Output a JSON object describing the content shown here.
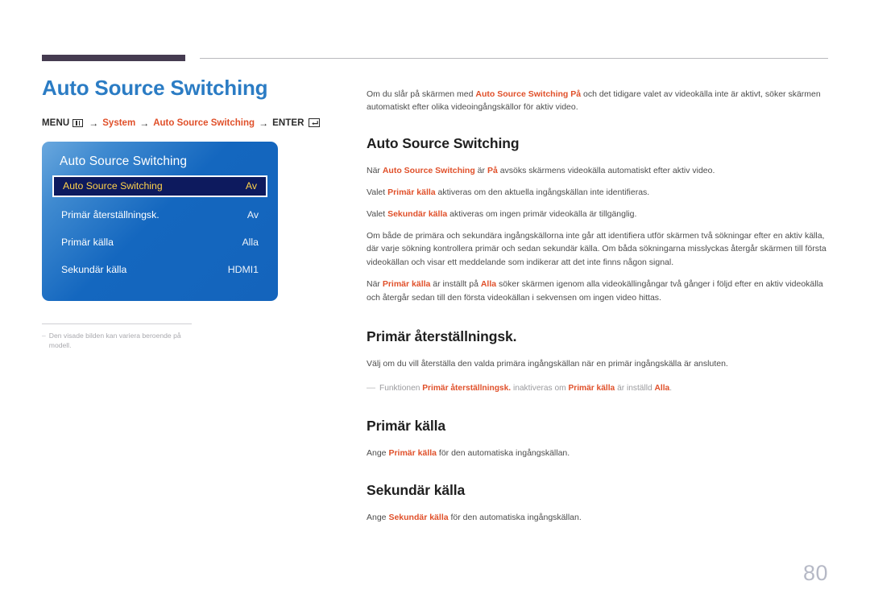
{
  "page": {
    "number": "80"
  },
  "left": {
    "title": "Auto Source Switching",
    "breadcrumb": {
      "menu_label": "MENU",
      "menu_icon": "menu-grid-icon",
      "arrow": "→",
      "item_system": "System",
      "item_auto_source": "Auto Source Switching",
      "enter_label": "ENTER",
      "enter_icon": "enter-return-icon"
    },
    "osd": {
      "title": "Auto Source Switching",
      "rows": [
        {
          "label": "Auto Source Switching",
          "value": "Av",
          "selected": true
        },
        {
          "label": "Primär återställningsk.",
          "value": "Av",
          "selected": false
        },
        {
          "label": "Primär källa",
          "value": "Alla",
          "selected": false
        },
        {
          "label": "Sekundär källa",
          "value": "HDMI1",
          "selected": false
        }
      ]
    },
    "note": {
      "dash": "–",
      "text": "Den visade bilden kan variera beroende på modell."
    }
  },
  "right": {
    "intro": {
      "p1_a": "Om du slår på skärmen med ",
      "p1_hl": "Auto Source Switching På",
      "p1_b": " och det tidigare valet av videokälla inte är aktivt, söker skärmen automatiskt efter olika videoingångskällor för aktiv video."
    },
    "sections": [
      {
        "heading": "Auto Source Switching",
        "p1_a": "När ",
        "p1_hl1": "Auto Source Switching",
        "p1_b": " är ",
        "p1_hl2": "På",
        "p1_c": " avsöks skärmens videokälla automatiskt efter aktiv video.",
        "p2_a": "Valet ",
        "p2_hl": "Primär källa",
        "p2_b": " aktiveras om den aktuella ingångskällan inte identifieras.",
        "p3_a": "Valet ",
        "p3_hl": "Sekundär källa",
        "p3_b": " aktiveras om ingen primär videokälla är tillgänglig.",
        "p4": "Om både de primära och sekundära ingångskällorna inte går att identifiera utför skärmen två sökningar efter en aktiv källa, där varje sökning kontrollera primär och sedan sekundär källa. Om båda sökningarna misslyckas återgår skärmen till första videokällan och visar ett meddelande som indikerar att det inte finns någon signal.",
        "p5_a": "När ",
        "p5_hl1": "Primär källa",
        "p5_b": " är inställt på ",
        "p5_hl2": "Alla",
        "p5_c": " söker skärmen igenom alla videokällingångar två gånger i följd efter en aktiv videokälla och återgår sedan till den första videokällan i sekvensen om ingen video hittas."
      },
      {
        "heading": "Primär återställningsk.",
        "p1": "Välj om du vill återställa den valda primära ingångskällan när en primär ingångskälla är ansluten.",
        "note_dash": "—",
        "note_a": "Funktionen ",
        "note_hl1": "Primär återställningsk.",
        "note_b": " inaktiveras om ",
        "note_hl2": "Primär källa",
        "note_c": " är inställd ",
        "note_hl3": "Alla",
        "note_d": "."
      },
      {
        "heading": "Primär källa",
        "p1_a": "Ange ",
        "p1_hl": "Primär källa",
        "p1_b": " för den automatiska ingångskällan."
      },
      {
        "heading": "Sekundär källa",
        "p1_a": "Ange ",
        "p1_hl": "Sekundär källa",
        "p1_b": " för den automatiska ingångskällan."
      }
    ]
  },
  "colors": {
    "title_blue": "#2b7cc4",
    "accent_orange": "#e0502a",
    "rule_dark": "#453b50",
    "osd_blue": "#1467bf",
    "osd_selected_bg": "#0d1a5e",
    "osd_selected_text": "#ffd24a",
    "page_number": "#b6b9c6"
  }
}
